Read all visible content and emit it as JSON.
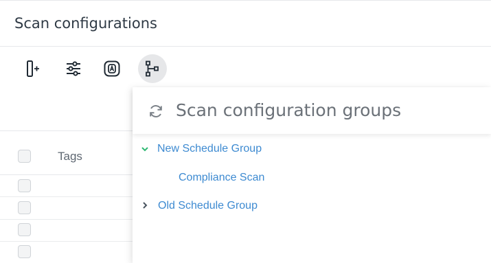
{
  "header": {
    "title": "Scan configurations"
  },
  "toolbar": {
    "buttons": [
      {
        "icon": "column-add-icon"
      },
      {
        "icon": "sliders-icon"
      },
      {
        "icon": "letter-a-badge-icon"
      },
      {
        "icon": "hierarchy-icon",
        "active": true
      }
    ]
  },
  "table": {
    "columns": [
      "Tags"
    ],
    "rows": [
      "",
      "",
      "",
      ""
    ]
  },
  "panel": {
    "title": "Scan configuration groups",
    "refresh_icon": "refresh-icon",
    "groups": [
      {
        "label": "New Schedule Group",
        "expanded": true,
        "children": [
          "Compliance Scan"
        ]
      },
      {
        "label": "Old Schedule Group",
        "expanded": false,
        "children": []
      }
    ]
  },
  "colors": {
    "link": "#3d8ad1",
    "expanded_chevron": "#2eb872",
    "collapsed_chevron": "#4a5560",
    "active_button_bg": "#e6e7e9"
  }
}
